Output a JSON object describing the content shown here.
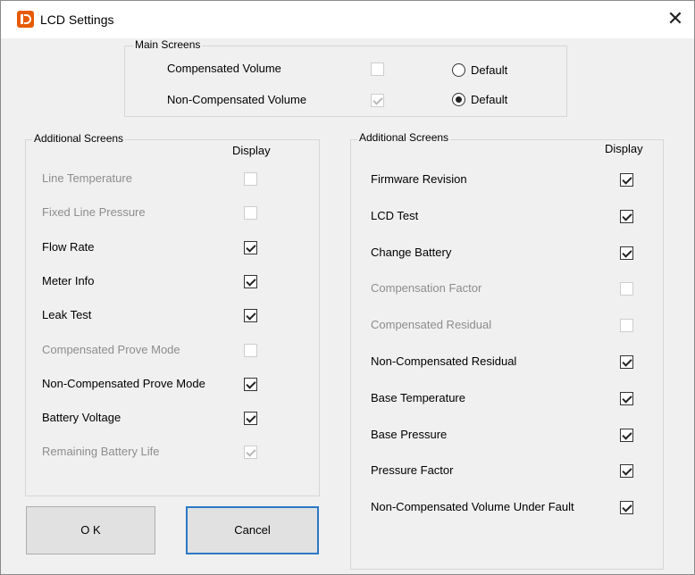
{
  "window": {
    "title": "LCD Settings",
    "icon": "app-logo-icon",
    "close_label": "✕"
  },
  "main_screens": {
    "title": "Main Screens",
    "rows": [
      {
        "label": "Compensated Volume",
        "checked": false,
        "enabled": false,
        "radio_label": "Default",
        "radio_selected": false
      },
      {
        "label": "Non-Compensated Volume",
        "checked": true,
        "enabled": false,
        "radio_label": "Default",
        "radio_selected": true
      }
    ]
  },
  "additional_left": {
    "title": "Additional Screens",
    "display_header": "Display",
    "items": [
      {
        "label": "Line Temperature",
        "checked": false,
        "enabled": false
      },
      {
        "label": "Fixed Line Pressure",
        "checked": false,
        "enabled": false
      },
      {
        "label": "Flow Rate",
        "checked": true,
        "enabled": true
      },
      {
        "label": "Meter Info",
        "checked": true,
        "enabled": true
      },
      {
        "label": "Leak Test",
        "checked": true,
        "enabled": true
      },
      {
        "label": "Compensated Prove Mode",
        "checked": false,
        "enabled": false
      },
      {
        "label": "Non-Compensated Prove Mode",
        "checked": true,
        "enabled": true
      },
      {
        "label": "Battery Voltage",
        "checked": true,
        "enabled": true
      },
      {
        "label": "Remaining Battery Life",
        "checked": true,
        "enabled": false
      }
    ]
  },
  "additional_right": {
    "title": "Additional Screens",
    "display_header": "Display",
    "items": [
      {
        "label": "Firmware Revision",
        "checked": true,
        "enabled": true
      },
      {
        "label": "LCD Test",
        "checked": true,
        "enabled": true
      },
      {
        "label": "Change Battery",
        "checked": true,
        "enabled": true
      },
      {
        "label": "Compensation Factor",
        "checked": false,
        "enabled": false
      },
      {
        "label": "Compensated Residual",
        "checked": false,
        "enabled": false
      },
      {
        "label": "Non-Compensated Residual",
        "checked": true,
        "enabled": true
      },
      {
        "label": "Base Temperature",
        "checked": true,
        "enabled": true
      },
      {
        "label": "Base Pressure",
        "checked": true,
        "enabled": true
      },
      {
        "label": " Pressure Factor",
        "checked": true,
        "enabled": true
      },
      {
        "label": "Non-Compensated Volume Under Fault",
        "checked": true,
        "enabled": true
      }
    ]
  },
  "buttons": {
    "ok_label": "O K",
    "cancel_label": "Cancel"
  },
  "colors": {
    "background": "#f0f0f0",
    "disabled_text": "#8d8d8d",
    "focus_border": "#2b78c5",
    "logo": "#e85a00"
  }
}
